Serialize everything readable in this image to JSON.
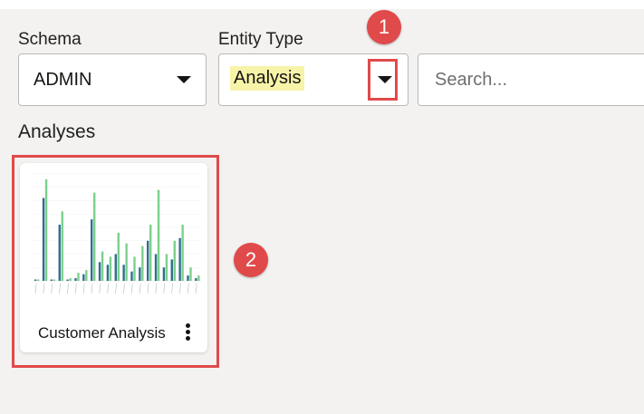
{
  "schema": {
    "label": "Schema",
    "value": "ADMIN"
  },
  "entity_type": {
    "label": "Entity Type",
    "value": "Analysis"
  },
  "search": {
    "placeholder": "Search..."
  },
  "section_title": "Analyses",
  "card": {
    "title": "Customer Analysis"
  },
  "callouts": {
    "one": "1",
    "two": "2"
  },
  "colors": {
    "accent_red": "#e04a4a",
    "highlight": "#f7f3a9",
    "bar_dark": "#2f6f8f",
    "bar_light": "#7bd08a"
  },
  "chart_data": {
    "type": "bar",
    "categories": [
      "c1",
      "c2",
      "c3",
      "c4",
      "c5",
      "c6",
      "c7",
      "c8",
      "c9",
      "c10",
      "c11",
      "c12",
      "c13",
      "c14",
      "c15",
      "c16",
      "c17",
      "c18",
      "c19",
      "c20",
      "c21"
    ],
    "series": [
      {
        "values": [
          5,
          310,
          5,
          210,
          5,
          10,
          25,
          230,
          70,
          60,
          100,
          60,
          35,
          50,
          150,
          100,
          50,
          80,
          160,
          20,
          10
        ]
      },
      {
        "values": [
          5,
          380,
          5,
          260,
          10,
          30,
          40,
          330,
          110,
          90,
          180,
          140,
          90,
          130,
          210,
          340,
          100,
          150,
          210,
          50,
          20
        ]
      }
    ],
    "ylim": [
      0,
      400
    ]
  }
}
